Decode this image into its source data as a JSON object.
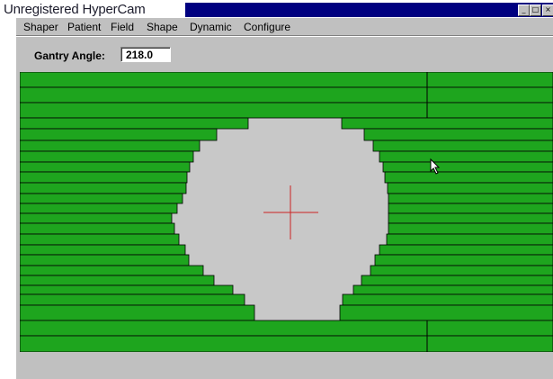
{
  "window": {
    "title": "Unregistered HyperCam",
    "controls": {
      "minimize": "_",
      "maximize": "□",
      "close": "×"
    }
  },
  "menu": [
    {
      "label": "Shaper"
    },
    {
      "label": "Patient"
    },
    {
      "label": "Field"
    },
    {
      "label": "Shape"
    },
    {
      "label": "Dynamic"
    },
    {
      "label": "Configure"
    }
  ],
  "toolbar": {
    "gantry_label": "Gantry Angle:",
    "gantry_value": "218.0"
  },
  "field_view": {
    "background_color": "#c8c8c8",
    "leaf_color": "#1ea51e",
    "leaf_edge_color": "#000000",
    "crosshair_color": "#cc2222",
    "cursor_icon": "arrow-cursor-icon"
  }
}
